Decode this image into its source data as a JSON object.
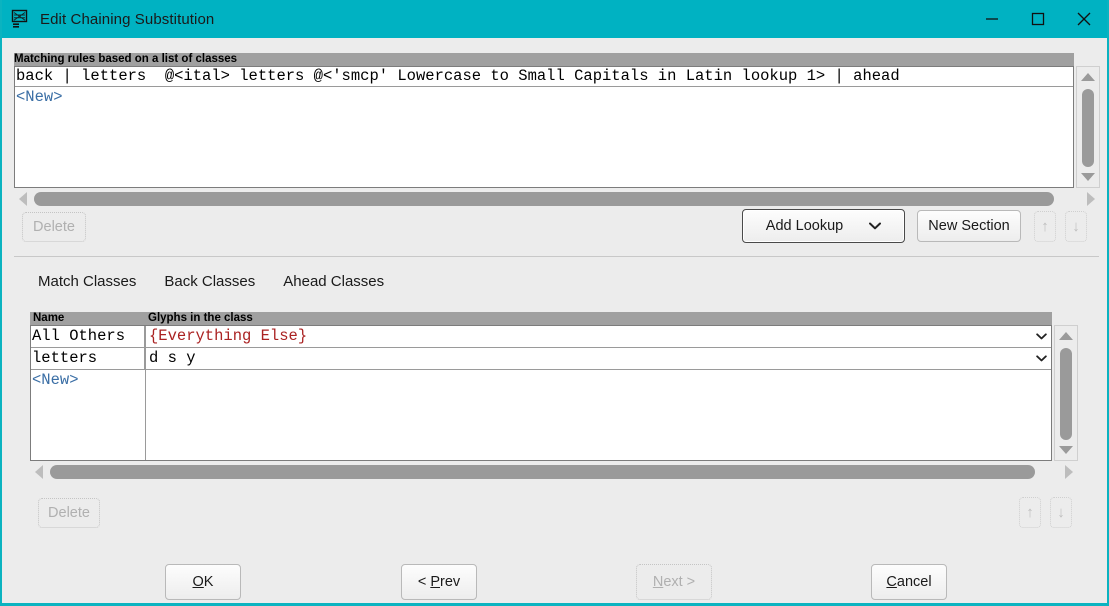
{
  "window": {
    "title": "Edit Chaining Substitution",
    "icon": "fontforge-glyph-icon",
    "accent_color": "#00b2c2",
    "controls": {
      "minimize": "minimize-icon",
      "maximize": "maximize-icon",
      "close": "close-icon"
    }
  },
  "rules_section": {
    "header": "Matching rules based on a list of classes",
    "rows": [
      "back | letters  @<ital> letters @<'smcp' Lowercase to Small Capitals in Latin lookup 1> | ahead",
      "<New>"
    ],
    "scrollbars": {
      "vertical": "vertical-scrollbar",
      "horizontal": "horizontal-scrollbar"
    }
  },
  "rules_toolbar": {
    "delete_label": "Delete",
    "delete_enabled": false,
    "add_lookup_label": "Add Lookup",
    "add_lookup_chevron": "chevron-down-icon",
    "new_section_label": "New Section",
    "move_up": "arrow-up-icon",
    "move_down": "arrow-down-icon"
  },
  "tabs": {
    "selected": "Match Classes",
    "items": [
      {
        "label": "Match Classes"
      },
      {
        "label": "Back Classes"
      },
      {
        "label": "Ahead Classes"
      }
    ]
  },
  "class_grid": {
    "columns": [
      "Name",
      "Glyphs in the class"
    ],
    "rows": [
      {
        "name": "All Others",
        "glyphs": "{Everything Else}",
        "glyphs_color": "#aa2222",
        "name_color": "#000000",
        "has_dropdown": true
      },
      {
        "name": "letters",
        "glyphs": "d s y",
        "glyphs_color": "#000000",
        "name_color": "#000000",
        "has_dropdown": true
      },
      {
        "name": "<New>",
        "glyphs": "",
        "glyphs_color": "#000000",
        "name_color": "#3a6ea5",
        "has_dropdown": false
      }
    ]
  },
  "grid_toolbar": {
    "delete_label": "Delete",
    "delete_enabled": false,
    "move_up": "arrow-up-icon",
    "move_down": "arrow-down-icon"
  },
  "footer": {
    "ok_label": "OK",
    "prev_label": "< Prev",
    "next_label": "Next >",
    "next_enabled": false,
    "cancel_label": "Cancel"
  }
}
